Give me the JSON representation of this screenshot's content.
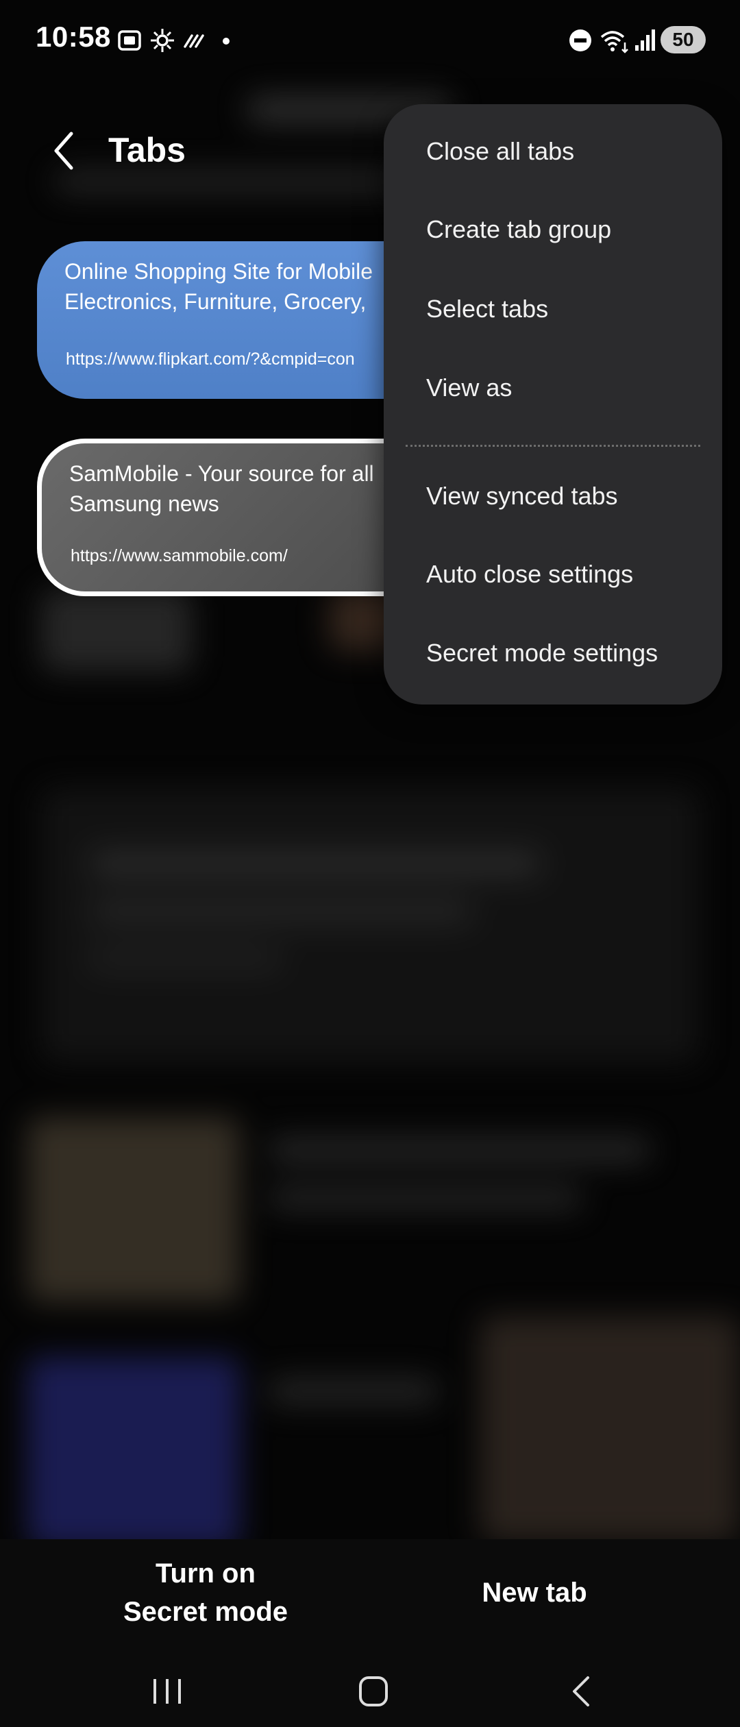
{
  "status_bar": {
    "time": "10:58",
    "battery": "50",
    "icons_left": [
      "screenshot-icon",
      "bixby-icon",
      "data-saver-icon",
      "notification-dot-icon"
    ],
    "icons_right": [
      "do-not-disturb-icon",
      "wifi-icon",
      "signal-icon",
      "battery-icon"
    ]
  },
  "header": {
    "title": "Tabs"
  },
  "tabs": [
    {
      "title": "Online Shopping Site for Mobile\nElectronics, Furniture, Grocery,",
      "url": "https://www.flipkart.com/?&cmpid=con",
      "color": "#5a8ad0",
      "active": false
    },
    {
      "title": "SamMobile - Your source for all\nSamsung news",
      "url": "https://www.sammobile.com/",
      "color": "#5f5f5f",
      "active": true
    }
  ],
  "menu": {
    "items": [
      {
        "label": "Close all tabs"
      },
      {
        "label": "Create tab group"
      },
      {
        "label": "Select tabs"
      },
      {
        "label": "View as"
      },
      {
        "label": "View synced tabs"
      },
      {
        "label": "Auto close settings"
      },
      {
        "label": "Secret mode settings"
      }
    ]
  },
  "bottom_bar": {
    "secret_mode_line1": "Turn on",
    "secret_mode_line2": "Secret mode",
    "new_tab": "New tab"
  },
  "nav_bar": {
    "buttons": [
      "recents-icon",
      "home-icon",
      "back-icon"
    ]
  },
  "colors": {
    "background": "#050505",
    "menu_bg": "#2b2b2d",
    "tab_blue": "#5a8ad0",
    "tab_gray": "#5f5f5f",
    "text": "#ffffff"
  }
}
